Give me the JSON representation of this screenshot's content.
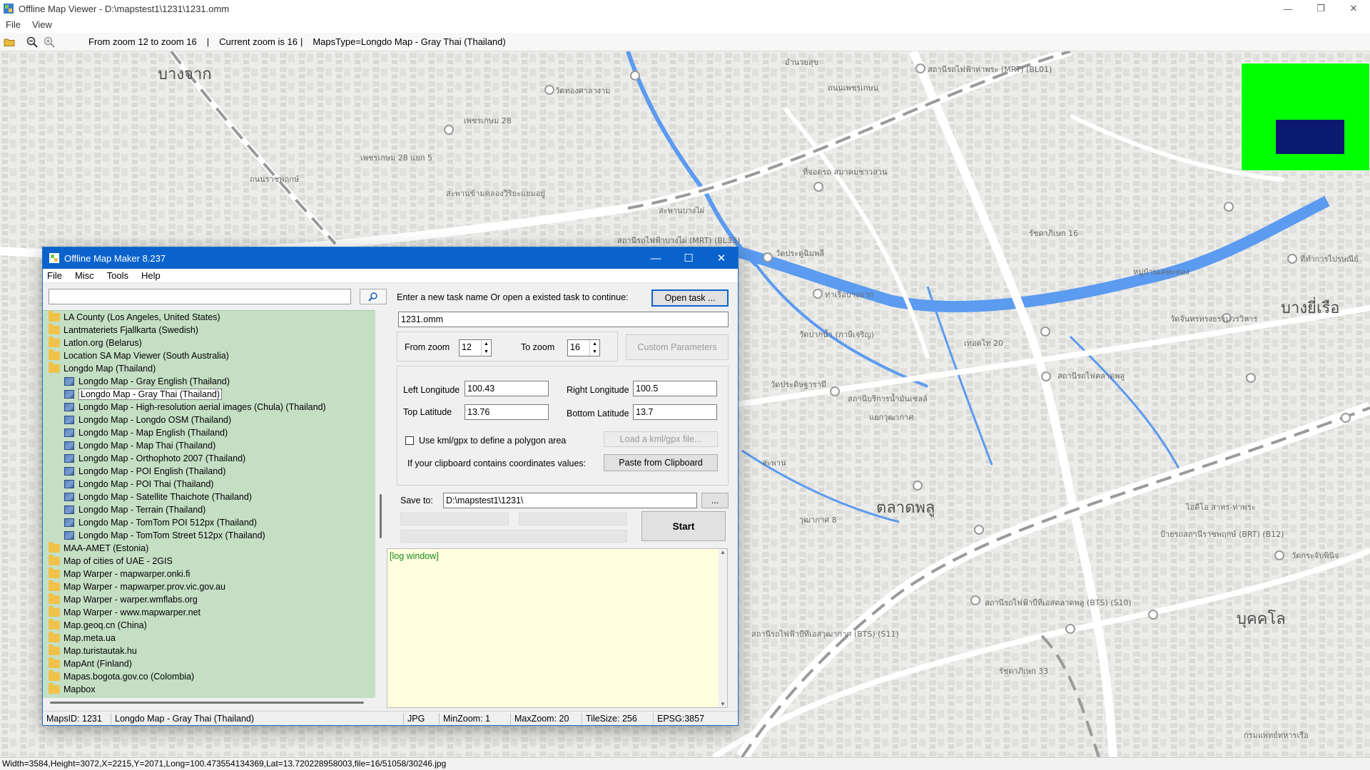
{
  "viewer": {
    "title": "Offline Map Viewer - D:\\mapstest1\\1231\\1231.omm",
    "menu": [
      "File",
      "View"
    ],
    "toolbar": {
      "zoom_range": "From zoom 12 to zoom 16",
      "current_zoom": "Current zoom is 16",
      "separator": "|",
      "maps_type": "MapsType=Longdo Map - Gray Thai (Thailand)"
    },
    "status": "Width=3584,Height=3072,X=2215,Y=2071,Long=100.473554134369,Lat=13.720228958003,file=16/51058/30246.jpg"
  },
  "map_labels": [
    "บางจาก",
    "บางยี่เรือ",
    "ตลาดพลู",
    "บุคคโล",
    "สถานีรถไฟฟ้าท่าพระ (MRT) (BL01)",
    "ถนนเพชรเกษม",
    "วัดทองศาลางาม",
    "เพชรเกษม 28",
    "เพชรเกษม 28 แยก 5",
    "สะพานข้ามคลองวิริยะแยมอยู่",
    "สะพานบางไผ่",
    "สถานีรถไฟฟ้าบางไผ่ (MRT) (BL33)",
    "วัดประดู่ฉิมพลี",
    "ที่จอดรถ สมาคมชาวสวน",
    "ถนนราชพฤกษ์",
    "ท่าเรือบางแวก",
    "วัดปากน้ำ (ภาษีเจริญ)",
    "หมู่บ้านเคหะทอง",
    "วัดจันทรทรงธรรมวรวิหาร",
    "เทอดไท 20",
    "สถานีรถไฟตลาดพลู",
    "วัดประดิษฐารามี",
    "สถานีบริการน้ำมันเชลล์",
    "แยกวุฒากาศ",
    "รัชดาภิเษก 16",
    "ไอดีโอ สาทร-ท่าพระ",
    "ป้ายรถสถานีราชพฤกษ์ (BRT) (B12)",
    "วัดกระจับพินิจ",
    "สถานีรถไฟฟ้าบีทีเอสตลาดพลู (BTS) (S10)",
    "สถานีรถไฟฟ้าบีทีเอสวุฒากาศ (BTS) (S11)",
    "รัชดาภิเษก 33",
    "กรมแพทย์ทหารเรือ",
    "สะพาน",
    "วุฒากาศ 8",
    "ที่ทำการไปรษณีย์",
    "อำนวยสุข"
  ],
  "dialog": {
    "title": "Offline Map Maker 8.237",
    "menu": [
      "File",
      "Misc",
      "Tools",
      "Help"
    ],
    "search": {
      "value": ""
    },
    "tree": [
      {
        "label": "LA County (Los Angeles, United States)",
        "level": 0,
        "type": "folder"
      },
      {
        "label": "Lantmateriets Fjallkarta (Swedish)",
        "level": 0,
        "type": "folder"
      },
      {
        "label": "Latlon.org (Belarus)",
        "level": 0,
        "type": "folder"
      },
      {
        "label": "Location SA Map Viewer (South Australia)",
        "level": 0,
        "type": "folder"
      },
      {
        "label": "Longdo Map (Thailand)",
        "level": 0,
        "type": "folder-open"
      },
      {
        "label": "Longdo Map - Gray English (Thailand)",
        "level": 1,
        "type": "map"
      },
      {
        "label": "Longdo Map - Gray Thai (Thailand)",
        "level": 1,
        "type": "map",
        "selected": true
      },
      {
        "label": "Longdo Map - High-resolution aerial images (Chula) (Thailand)",
        "level": 1,
        "type": "map"
      },
      {
        "label": "Longdo Map - Longdo OSM (Thailand)",
        "level": 1,
        "type": "map"
      },
      {
        "label": "Longdo Map - Map English (Thailand)",
        "level": 1,
        "type": "map"
      },
      {
        "label": "Longdo Map - Map Thai (Thailand)",
        "level": 1,
        "type": "map"
      },
      {
        "label": "Longdo Map - Orthophoto 2007 (Thailand)",
        "level": 1,
        "type": "map"
      },
      {
        "label": "Longdo Map - POI English (Thailand)",
        "level": 1,
        "type": "map"
      },
      {
        "label": "Longdo Map - POI Thai (Thailand)",
        "level": 1,
        "type": "map"
      },
      {
        "label": "Longdo Map - Satellite Thaichote (Thailand)",
        "level": 1,
        "type": "map"
      },
      {
        "label": "Longdo Map - Terrain (Thailand)",
        "level": 1,
        "type": "map"
      },
      {
        "label": "Longdo Map - TomTom POI 512px (Thailand)",
        "level": 1,
        "type": "map"
      },
      {
        "label": "Longdo Map - TomTom Street 512px (Thailand)",
        "level": 1,
        "type": "map"
      },
      {
        "label": "MAA-AMET (Estonia)",
        "level": 0,
        "type": "folder"
      },
      {
        "label": "Map of cities of UAE - 2GIS",
        "level": 0,
        "type": "folder"
      },
      {
        "label": "Map Warper - mapwarper.onki.fi",
        "level": 0,
        "type": "folder"
      },
      {
        "label": "Map Warper - mapwarper.prov.vic.gov.au",
        "level": 0,
        "type": "folder"
      },
      {
        "label": "Map Warper - warper.wmflabs.org",
        "level": 0,
        "type": "folder"
      },
      {
        "label": "Map Warper - www.mapwarper.net",
        "level": 0,
        "type": "folder"
      },
      {
        "label": "Map.geoq.cn (China)",
        "level": 0,
        "type": "folder"
      },
      {
        "label": "Map.meta.ua",
        "level": 0,
        "type": "folder"
      },
      {
        "label": "Map.turistautak.hu",
        "level": 0,
        "type": "folder"
      },
      {
        "label": "MapAnt (Finland)",
        "level": 0,
        "type": "folder"
      },
      {
        "label": "Mapas.bogota.gov.co (Colombia)",
        "level": 0,
        "type": "folder"
      },
      {
        "label": "Mapbox",
        "level": 0,
        "type": "folder"
      }
    ],
    "task_prompt": "Enter a new task name Or open a existed task to continue:",
    "open_task_label": "Open task ...",
    "task_name": "1231.omm",
    "from_zoom_label": "From zoom",
    "from_zoom": "12",
    "to_zoom_label": "To zoom",
    "to_zoom": "16",
    "custom_params_label": "Custom Parameters",
    "left_lon_label": "Left Longitude",
    "left_lon": "100.43",
    "right_lon_label": "Right Longitude",
    "right_lon": "100.5",
    "top_lat_label": "Top Latitude",
    "top_lat": "13.76",
    "bottom_lat_label": "Bottom Latitude",
    "bottom_lat": "13.7",
    "kml_label": "Use kml/gpx to define a polygon area",
    "load_kml_label": "Load a kml/gpx file...",
    "clipboard_label": "If your clipboard contains coordinates values:",
    "paste_label": "Paste from Clipboard",
    "save_to_label": "Save to:",
    "save_to": "D:\\mapstest1\\1231\\",
    "browse_label": "...",
    "start_label": "Start",
    "log_text": "[log window]",
    "status": {
      "maps_id": "MapsID: 1231",
      "maps_name": "Longdo Map - Gray Thai (Thailand)",
      "format": "JPG",
      "min_zoom": "MinZoom: 1",
      "max_zoom": "MaxZoom: 20",
      "tile_size": "TileSize: 256",
      "epsg": "EPSG:3857"
    }
  },
  "colors": {
    "accent": "#0a63cc",
    "tree_bg": "#c5dfc5",
    "water": "#5b9bf0",
    "overview": "#00ff00",
    "overview_view": "#0a1a6e"
  }
}
